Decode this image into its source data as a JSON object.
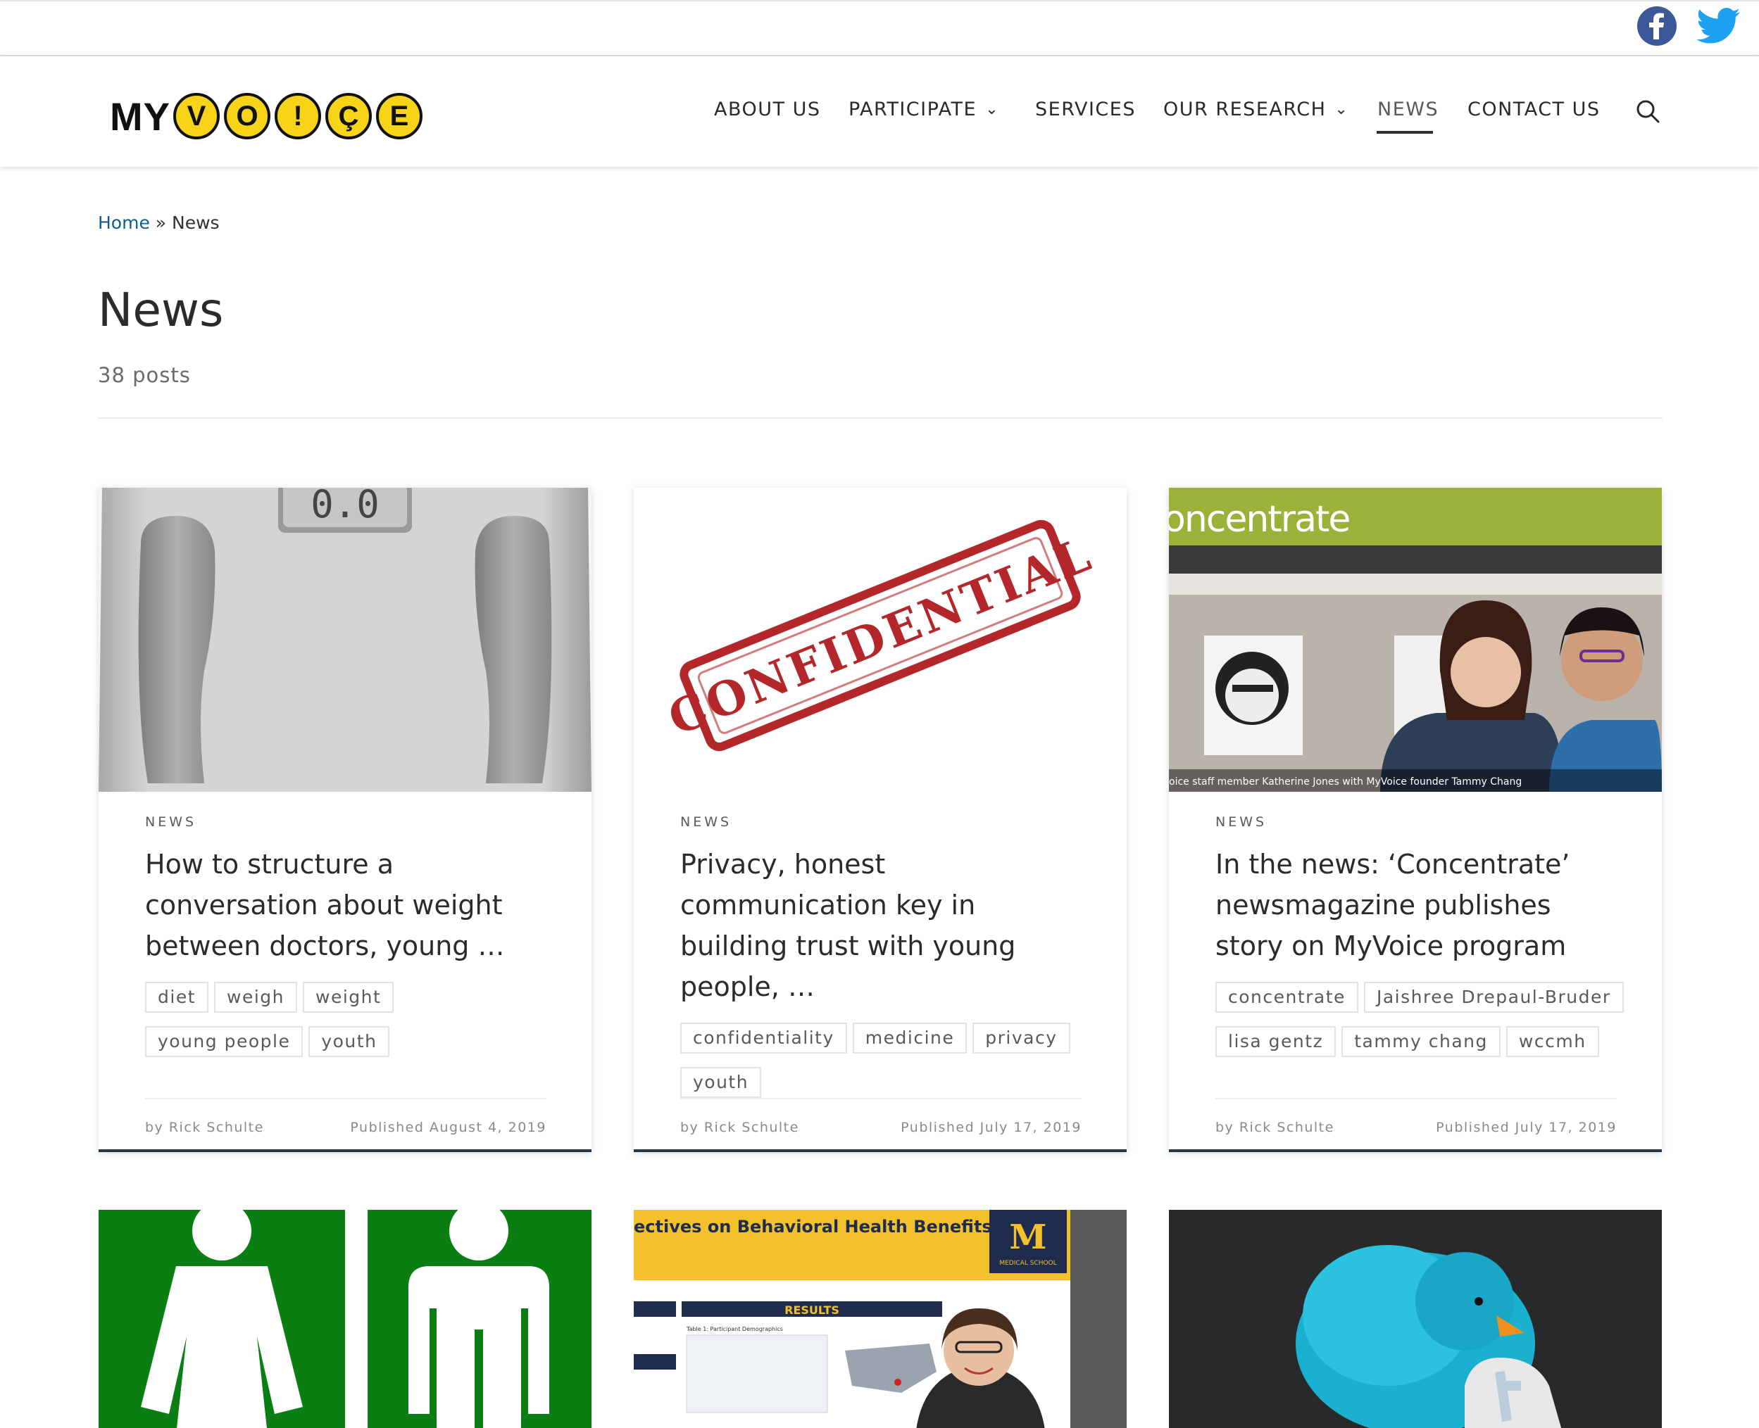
{
  "social": {
    "facebook_icon": "facebook-icon",
    "twitter_icon": "twitter-icon",
    "facebook_color": "#3b5998",
    "twitter_color": "#1da1f2"
  },
  "header": {
    "logo": {
      "word": "MY",
      "letters": [
        "V",
        "O",
        "!",
        "Ç",
        "E"
      ]
    },
    "nav": [
      {
        "label": "ABOUT US",
        "has_dropdown": false
      },
      {
        "label": "PARTICIPATE",
        "has_dropdown": true
      },
      {
        "label": "SERVICES",
        "has_dropdown": false
      },
      {
        "label": "OUR RESEARCH",
        "has_dropdown": true
      },
      {
        "label": "NEWS",
        "has_dropdown": false,
        "active": true
      },
      {
        "label": "CONTACT US",
        "has_dropdown": false
      }
    ],
    "chevron": "⌄",
    "search_icon": "search-icon"
  },
  "breadcrumb": {
    "home": "Home",
    "separator": "»",
    "current": "News"
  },
  "page": {
    "title": "News",
    "post_count": "38 posts"
  },
  "posts": [
    {
      "category": "NEWS",
      "title": "How to structure a conversation about weight between doctors, young …",
      "tags": [
        "diet",
        "weigh",
        "weight",
        "young people",
        "youth"
      ],
      "author": "by Rick Schulte",
      "published": "Published August 4, 2019",
      "image": "bathroom-scale",
      "scale_display": "0.0"
    },
    {
      "category": "NEWS",
      "title": "Privacy, honest communication key in building trust with young people, …",
      "tags": [
        "confidentiality",
        "medicine",
        "privacy",
        "youth"
      ],
      "author": "by Rick Schulte",
      "published": "Published July 17, 2019",
      "image": "confidential-stamp",
      "stamp_text": "CONFIDENTIAL"
    },
    {
      "category": "NEWS",
      "title": "In the news: ‘Concentrate’ newsmagazine publishes story on MyVoice program",
      "tags": [
        "concentrate",
        "Jaishree Drepaul-Bruder",
        "lisa gentz",
        "tammy chang",
        "wccmh"
      ],
      "author": "by Rick Schulte",
      "published": "Published July 17, 2019",
      "image": "concentrate-photo",
      "image_banner": "oncentrate",
      "image_caption": "oice staff member Katherine Jones with MyVoice founder Tammy Chang"
    }
  ],
  "second_row": [
    {
      "image": "restroom-pictogram"
    },
    {
      "image": "research-poster",
      "poster_heading": "ectives on Behavioral Health Benefits",
      "poster_results": "RESULTS",
      "poster_table": "Table 1: Participant Demographics",
      "poster_school": "MEDICAL SCHOOL",
      "poster_logo": "M"
    },
    {
      "image": "blue-chick-twitter-egg"
    }
  ]
}
